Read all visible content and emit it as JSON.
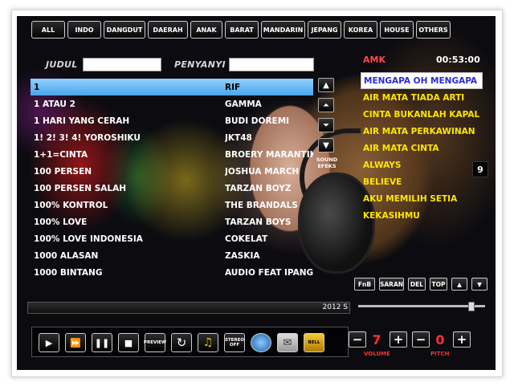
{
  "categories": [
    "ALL",
    "INDO",
    "DANGDUT",
    "DAERAH",
    "ANAK",
    "BARAT",
    "MANDARIN",
    "JEPANG",
    "KOREA",
    "HOUSE",
    "OTHERS"
  ],
  "search": {
    "title_label": "JUDUL",
    "singer_label": "PENYANYI",
    "title_value": "",
    "singer_value": ""
  },
  "songs": [
    {
      "title": "1",
      "artist": "RIF"
    },
    {
      "title": "1 ATAU 2",
      "artist": "GAMMA"
    },
    {
      "title": "1 HARI YANG CERAH",
      "artist": "BUDI DOREMI"
    },
    {
      "title": "1! 2! 3! 4! YOROSHIKU",
      "artist": "JKT48"
    },
    {
      "title": "1+1=CINTA",
      "artist": "BROERY MARANTIKA"
    },
    {
      "title": "100 PERSEN",
      "artist": "JOSHUA MARCH"
    },
    {
      "title": "100 PERSEN SALAH",
      "artist": "TARZAN BOYZ"
    },
    {
      "title": "100% KONTROL",
      "artist": "THE BRANDALS"
    },
    {
      "title": "100% LOVE",
      "artist": "TARZAN BOYS"
    },
    {
      "title": "100% LOVE INDONESIA",
      "artist": "COKELAT"
    },
    {
      "title": "1000 ALASAN",
      "artist": "ZASKIA"
    },
    {
      "title": "1000 BINTANG",
      "artist": "AUDIO FEAT IPANG"
    }
  ],
  "nav": {
    "up": "▲",
    "page_up": "⏶",
    "page_down": "⏷",
    "down": "▼",
    "sound_effects": "SOUND EFEKS"
  },
  "queue": {
    "header": "AMK",
    "time": "00:53:00",
    "items": [
      "MENGAPA OH MENGAPA",
      "AIR MATA TIADA ARTI",
      "CINTA BUKANLAH KAPAL",
      "AIR MATA PERKAWINAN",
      "AIR MATA CINTA",
      "ALWAYS",
      "BELIEVE",
      "AKU MEMILIH SETIA",
      "KEKASIHMU"
    ],
    "count": "9",
    "buttons": {
      "fnb": "FnB",
      "saran": "SARAN",
      "del": "DEL",
      "top": "TOP",
      "up": "▲",
      "down": "▼"
    }
  },
  "slider_level": 0.9,
  "progress": {
    "text": "2012 S"
  },
  "controls": {
    "play": "▶",
    "fast_forward": "⏩",
    "pause": "❚❚",
    "stop": "■",
    "preview": "PREVIEW",
    "repeat": "↻",
    "music": "♫",
    "stereo": "STEREO OFF",
    "bell": "BELL"
  },
  "volume": {
    "minus": "−",
    "value": "7",
    "plus": "+",
    "label": "VOLUME"
  },
  "pitch": {
    "minus": "−",
    "value": "0",
    "plus": "+",
    "label": "PITCH"
  },
  "colors": {
    "selected_row": "#5ab4f0",
    "queue_text": "#ffe600",
    "queue_header": "#ff4a4a",
    "knob_value": "#ff3030"
  }
}
